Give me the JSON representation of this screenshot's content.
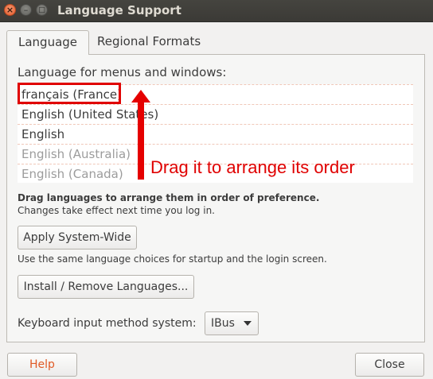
{
  "window": {
    "title": "Language Support"
  },
  "tabs": [
    {
      "label": "Language"
    },
    {
      "label": "Regional Formats"
    }
  ],
  "language_section": {
    "heading": "Language for menus and windows:",
    "languages": [
      {
        "label": "français (France)"
      },
      {
        "label": "English (United States)"
      },
      {
        "label": "English"
      },
      {
        "label": "English (Australia)"
      },
      {
        "label": "English (Canada)"
      }
    ],
    "drag_hint_bold": "Drag languages to arrange them in order of preference.",
    "drag_hint_note": "Changes take effect next time you log in."
  },
  "annotation": {
    "text": "Drag it to arrange its order",
    "color": "#e00000"
  },
  "apply_button": {
    "label": "Apply System-Wide"
  },
  "apply_note": "Use the same language choices for startup and the login screen.",
  "install_button": {
    "label": "Install / Remove Languages..."
  },
  "keyboard": {
    "label": "Keyboard input method system:",
    "selected": "IBus"
  },
  "footer": {
    "help_label": "Help",
    "close_label": "Close"
  },
  "colors": {
    "accent": "#e05a26",
    "titlebar": "#3c3b37"
  },
  "icons": [
    "close-icon",
    "minimize-icon",
    "maximize-icon",
    "chevron-down-icon",
    "up-arrow-icon"
  ]
}
